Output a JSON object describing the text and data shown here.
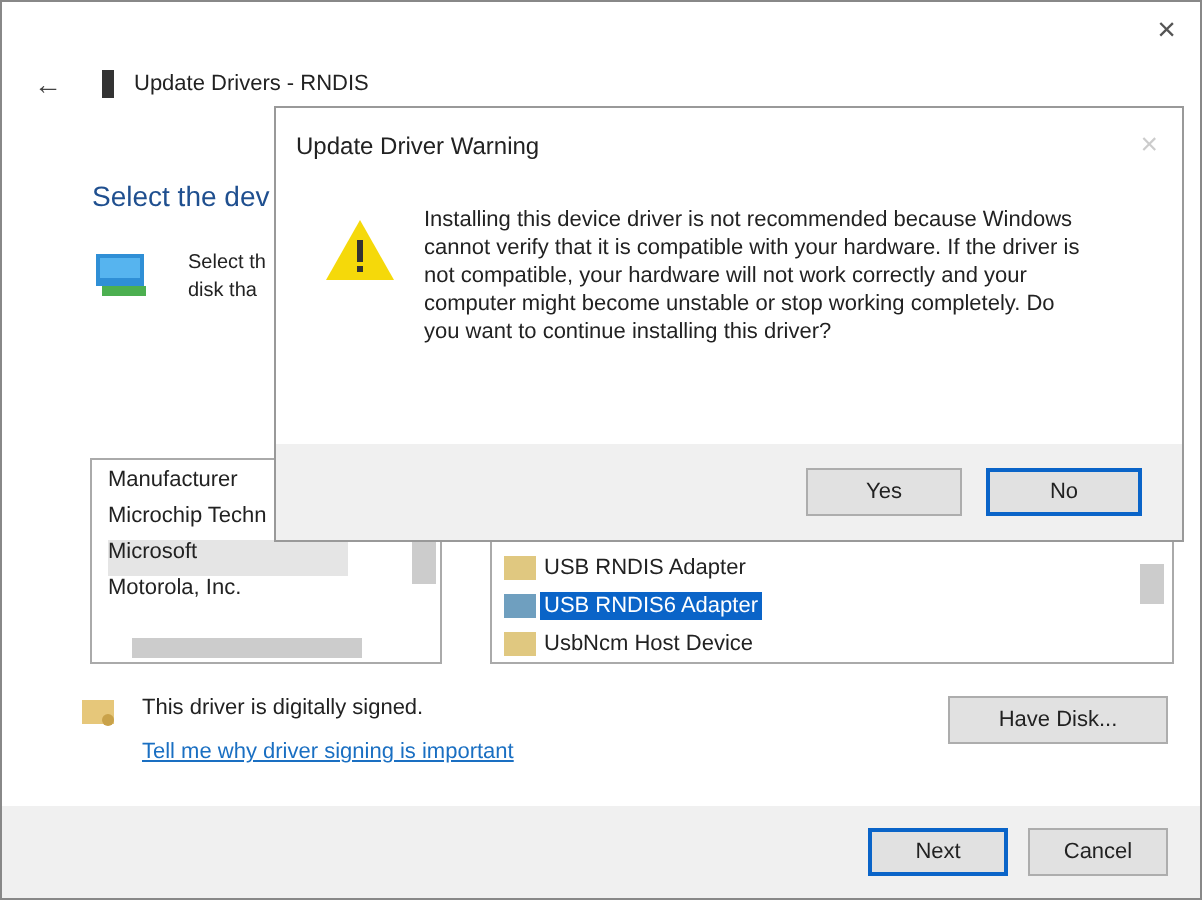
{
  "wizard": {
    "close": "×",
    "back": "←",
    "title": "Update Drivers - RNDIS",
    "heading": "Select the dev",
    "instructions": [
      "Select th",
      "disk tha"
    ],
    "manufacturer_list": {
      "header": "Manufacturer",
      "items": [
        {
          "label": "Microchip Techn",
          "selected": false
        },
        {
          "label": "Microsoft",
          "selected": true
        },
        {
          "label": "Motorola, Inc.",
          "selected": false
        }
      ]
    },
    "model_list": {
      "items": [
        {
          "label": "USB RNDIS Adapter",
          "selected": false
        },
        {
          "label": "USB RNDIS6 Adapter",
          "selected": true
        },
        {
          "label": "UsbNcm Host Device",
          "selected": false
        }
      ]
    },
    "signed_note": "This driver is digitally signed.",
    "link": "Tell me why driver signing is important",
    "have_disk": "Have Disk...",
    "buttons": [
      {
        "label": "Next",
        "default": true
      },
      {
        "label": "Cancel",
        "default": false
      }
    ]
  },
  "dialog": {
    "title": "Update Driver Warning",
    "close": "×",
    "message": "Installing this device driver is not recommended because Windows cannot verify that it is compatible with your hardware.  If the driver is not compatible, your hardware will not work correctly and your computer might become unstable or stop working completely.  Do you want to continue installing this driver?",
    "buttons": [
      {
        "label": "Yes",
        "default": false
      },
      {
        "label": "No",
        "default": true
      }
    ]
  }
}
